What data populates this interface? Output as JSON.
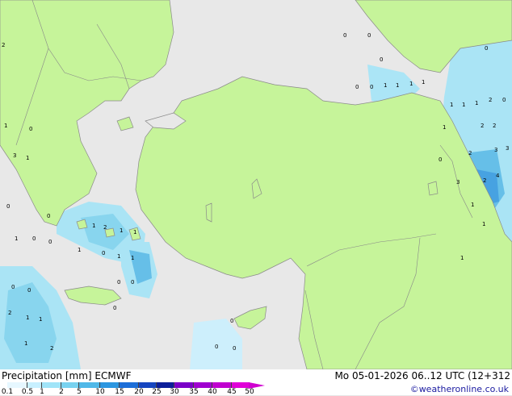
{
  "header": {
    "product": "Precipitation [mm]",
    "model": "ECMWF",
    "valid_time": "Mo 05-01-2026 06..12 UTC (12+312"
  },
  "credit": "©weatheronline.co.uk",
  "legend": {
    "labels": [
      "0.1",
      "0.5",
      "1",
      "2",
      "5",
      "10",
      "15",
      "20",
      "25",
      "30",
      "35",
      "40",
      "45",
      "50"
    ],
    "colors": [
      "#e6f7ff",
      "#c8f0ff",
      "#a0e4f8",
      "#78d2f0",
      "#50b8e8",
      "#2c96e0",
      "#1c6ed8",
      "#1646c0",
      "#0c1e9a",
      "#7a00c8",
      "#a000d0",
      "#c000d0",
      "#e000d8",
      "#f040e8"
    ]
  },
  "map": {
    "land_color": "#c6f49a",
    "sea_color": "#e8e8e8",
    "values": [
      "0",
      "0",
      "0",
      "0",
      "0",
      "1",
      "1",
      "1",
      "1",
      "1",
      "2",
      "2",
      "2",
      "2",
      "3",
      "3",
      "3",
      "4",
      "0",
      "1",
      "1",
      "2",
      "0",
      "1",
      "1",
      "1",
      "1",
      "2",
      "1",
      "3",
      "0",
      "1",
      "0",
      "1",
      "0",
      "0",
      "0",
      "1",
      "1",
      "2",
      "1",
      "1",
      "0",
      "1",
      "1",
      "0",
      "0",
      "0",
      "0",
      "2",
      "1",
      "1",
      "1",
      "2",
      "0",
      "0",
      "0",
      "0",
      "0"
    ]
  }
}
